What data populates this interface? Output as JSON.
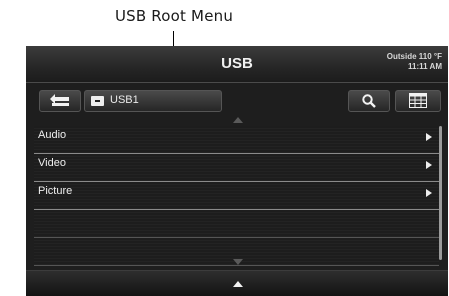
{
  "callout": {
    "label": "USB Root Menu"
  },
  "header": {
    "title": "USB",
    "temperature": "Outside 110 °F",
    "clock": "11:11 AM"
  },
  "toolbar": {
    "source_label": "USB1"
  },
  "menu": {
    "items": [
      {
        "label": "Audio"
      },
      {
        "label": "Video"
      },
      {
        "label": "Picture"
      }
    ]
  },
  "icons": {
    "back": "back-arrow-icon",
    "source": "usb-drive-icon",
    "search": "search-icon",
    "grid": "keypad-grid-icon",
    "item_arrow": "chevron-right-icon"
  },
  "colors": {
    "screen_bg": "#1e1e1e",
    "text": "#efefef",
    "divider": "#8a8a8a"
  }
}
